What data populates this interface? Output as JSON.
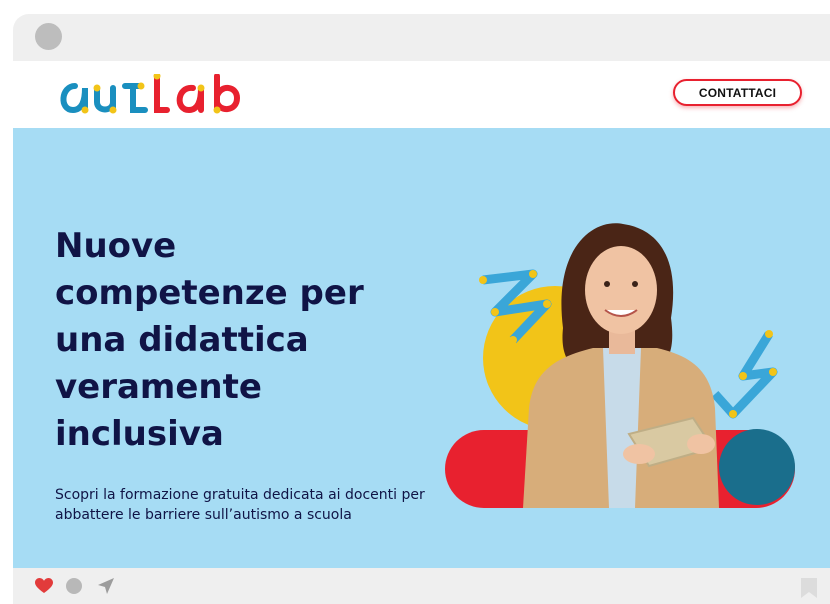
{
  "window": {
    "control_dot": "window-dot"
  },
  "header": {
    "logo_text": "autlab",
    "contact_label": "CONTATTACI"
  },
  "hero": {
    "title": "Nuove competenze per una didattica veramente inclusiva",
    "subtitle": "Scopri la formazione gratuita dedicata ai docenti per abbattere le barriere sull’autismo a scuola",
    "image": "woman-holding-tablet-illustration"
  },
  "actions": {
    "icons": [
      "heart-icon",
      "comment-icon",
      "send-icon",
      "bookmark-icon"
    ]
  },
  "colors": {
    "hero_bg": "#a6dcf4",
    "title": "#101446",
    "accent_red": "#e8212f",
    "logo_blue": "#1a8fbf",
    "yellow": "#f2c418",
    "teal": "#1a6e8c"
  }
}
